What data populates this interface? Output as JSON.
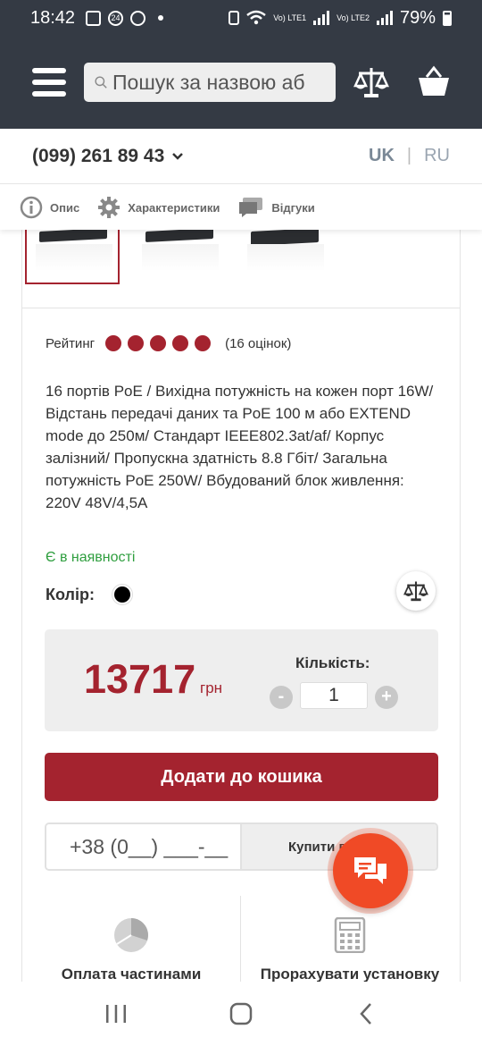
{
  "status_bar": {
    "time": "18:42",
    "notif_badge": "24",
    "net1": "Vo) LTE1",
    "net2": "Vo) LTE2",
    "battery": "79%"
  },
  "header": {
    "search_placeholder": "Пошук за назвою аб",
    "icons": [
      "menu-icon",
      "search-icon",
      "compare-icon",
      "cart-icon"
    ]
  },
  "contact": {
    "phone": "(099) 261 89 43",
    "lang_active": "UK",
    "lang_separator": "|",
    "lang_other": "RU"
  },
  "tabs": [
    {
      "label": "Опис",
      "icon": "info-icon"
    },
    {
      "label": "Характеристики",
      "icon": "gear-icon"
    },
    {
      "label": "Відгуки",
      "icon": "chat-icon"
    }
  ],
  "product": {
    "rating_label": "Рейтинг",
    "rating_value": 5,
    "rating_count": "(16 оцінок)",
    "description": "16 портів PoE / Вихідна потужність на кожен порт 16W/ Відстань передачі даних та PoE 100 м або EXTEND mode до 250м/ Стандарт IEEE802.3at/af/ Корпус залізний/ Пропускна здатність 8.8 Гбіт/ Загальна потужність PoE 250W/ Вбудований блок живлення: 220V 48V/4,5A",
    "stock": "Є в наявності",
    "color_label": "Колір:",
    "price": "13717",
    "currency": "грн",
    "qty_label": "Кількість:",
    "qty_value": "1",
    "qty_minus": "-",
    "qty_plus": "+",
    "add_to_cart": "Додати до кошика",
    "phone_placeholder": "+38 (0__) ___-__",
    "buy_one_click": "Купити в"
  },
  "features": [
    {
      "label": "Оплата частинами",
      "icon": "pie-chart-icon"
    },
    {
      "label": "Прорахувати установку",
      "icon": "calculator-icon"
    }
  ],
  "colors": {
    "header_bg": "#343a44",
    "brand_red": "#a4232f",
    "in_stock_green": "#2e9e3e",
    "chat_fab": "#f04a26"
  }
}
